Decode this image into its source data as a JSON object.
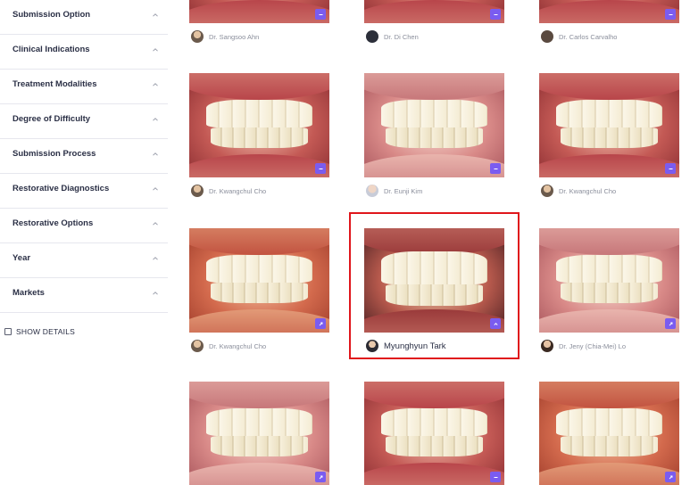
{
  "sidebar": {
    "filters": [
      {
        "label": "Submission Option"
      },
      {
        "label": "Clinical Indications"
      },
      {
        "label": "Treatment Modalities"
      },
      {
        "label": "Degree of Difficulty"
      },
      {
        "label": "Submission Process"
      },
      {
        "label": "Restorative Diagnostics"
      },
      {
        "label": "Restorative Options"
      },
      {
        "label": "Year"
      },
      {
        "label": "Markets"
      }
    ],
    "show_details": {
      "label": "SHOW DETAILS",
      "checked": false
    }
  },
  "gallery": {
    "cards": [
      {
        "doctor": "Dr. Sangsoo Ahn",
        "badge_icon": "minus-icon"
      },
      {
        "doctor": "Dr. Di Chen",
        "badge_icon": "minus-icon"
      },
      {
        "doctor": "Dr. Carlos Carvalho",
        "badge_icon": "minus-icon"
      },
      {
        "doctor": "Dr. Kwangchul Cho",
        "badge_icon": "minus-icon"
      },
      {
        "doctor": "Dr. Eunji Kim",
        "badge_icon": "minus-icon"
      },
      {
        "doctor": "Dr. Kwangchul Cho",
        "badge_icon": "minus-icon"
      },
      {
        "doctor": "Dr. Kwangchul Cho",
        "badge_icon": "expand-icon"
      },
      {
        "doctor": "Myunghyun Tark",
        "badge_icon": "chevron-up-icon"
      },
      {
        "doctor": "Dr. Jeny (Chia-Mei) Lo",
        "badge_icon": "expand-icon"
      },
      {
        "doctor": "",
        "badge_icon": "expand-icon"
      },
      {
        "doctor": "",
        "badge_icon": "minus-icon"
      },
      {
        "doctor": "",
        "badge_icon": "expand-icon"
      }
    ]
  },
  "colors": {
    "badge": "#7a5cf0",
    "highlight": "#e0161b",
    "divider": "#e6e7ee"
  }
}
